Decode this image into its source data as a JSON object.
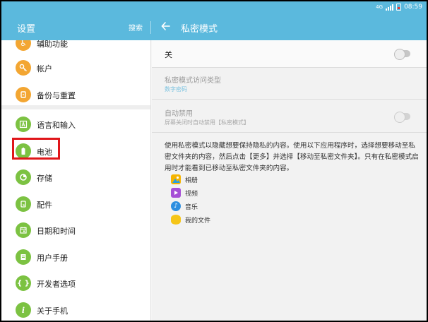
{
  "status": {
    "network": "4G",
    "time": "08:59"
  },
  "appbar": {
    "left_title": "设置",
    "search": "搜索",
    "right_title": "私密模式"
  },
  "sidebar": {
    "items": [
      {
        "label": "辅助功能",
        "icon": "accessibility-icon",
        "color": "#f3a632"
      },
      {
        "label": "帐户",
        "icon": "key-icon",
        "color": "#f3a632"
      },
      {
        "label": "备份与重置",
        "icon": "backup-icon",
        "color": "#f3a632"
      },
      {
        "label": "语言和输入",
        "icon": "language-icon",
        "color": "#7cc242"
      },
      {
        "label": "电池",
        "icon": "battery-icon",
        "color": "#7cc242"
      },
      {
        "label": "存储",
        "icon": "storage-icon",
        "color": "#7cc242"
      },
      {
        "label": "配件",
        "icon": "accessory-icon",
        "color": "#7cc242"
      },
      {
        "label": "日期和时间",
        "icon": "calendar-icon",
        "color": "#7cc242"
      },
      {
        "label": "用户手册",
        "icon": "manual-icon",
        "color": "#7cc242"
      },
      {
        "label": "开发者选项",
        "icon": "developer-icon",
        "color": "#7cc242"
      },
      {
        "label": "关于手机",
        "icon": "info-icon",
        "color": "#7cc242"
      }
    ]
  },
  "main": {
    "master_toggle_label": "关",
    "master_toggle_on": false,
    "access_type": {
      "title": "私密模式访问类型",
      "value": "数字密码"
    },
    "auto_disable": {
      "title": "自动禁用",
      "subtitle": "屏幕关闭时自动禁用【私密模式】",
      "on": false
    },
    "description": "使用私密模式以隐藏想要保持隐私的内容。使用以下应用程序时，选择想要移动至私密文件夹的内容，然后点击【更多】并选择【移动至私密文件夹】。只有在私密模式启用时才能看到已移动至私密文件夹的内容。",
    "apps": [
      {
        "label": "相册",
        "icon": "gallery-icon",
        "color": "#f5b400"
      },
      {
        "label": "视频",
        "icon": "video-icon",
        "color": "#a64fd6"
      },
      {
        "label": "音乐",
        "icon": "music-icon",
        "color": "#2d8fe0"
      },
      {
        "label": "我的文件",
        "icon": "my-files-icon",
        "color": "#f5c518"
      }
    ]
  },
  "colors": {
    "accent": "#5bb9dd",
    "highlight": "#e0161a"
  }
}
